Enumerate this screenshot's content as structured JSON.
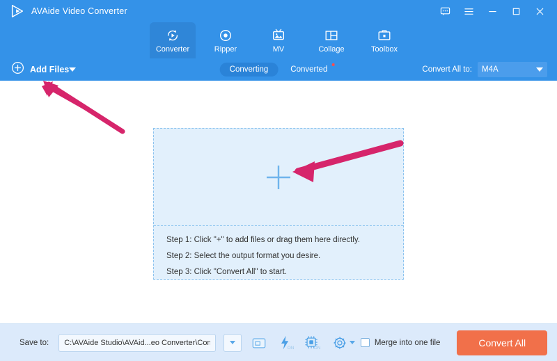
{
  "window": {
    "title": "AVAide Video Converter",
    "logo_icon": "play-triangle-logo",
    "controls": [
      {
        "name": "feedback",
        "icon": "chat-bubble-icon"
      },
      {
        "name": "menu",
        "icon": "hamburger-menu-icon"
      },
      {
        "name": "minimize",
        "icon": "minimize-icon"
      },
      {
        "name": "maximize",
        "icon": "maximize-icon"
      },
      {
        "name": "close",
        "icon": "close-icon"
      }
    ]
  },
  "tabs": [
    {
      "label": "Converter",
      "icon": "converter-icon",
      "active": true
    },
    {
      "label": "Ripper",
      "icon": "disc-icon",
      "active": false
    },
    {
      "label": "MV",
      "icon": "mv-image-icon",
      "active": false
    },
    {
      "label": "Collage",
      "icon": "collage-grid-icon",
      "active": false
    },
    {
      "label": "Toolbox",
      "icon": "toolbox-briefcase-icon",
      "active": false
    }
  ],
  "toolbar": {
    "add_files_label": "Add Files",
    "add_files_icon": "circle-plus-icon",
    "add_files_caret": "chevron-down-icon",
    "segments": [
      {
        "label": "Converting",
        "active": true,
        "badge": false
      },
      {
        "label": "Converted",
        "active": false,
        "badge": true
      }
    ],
    "convert_all_to_label": "Convert All to:",
    "format_value": "M4A"
  },
  "dropzone": {
    "plus_icon": "plus-icon",
    "steps": [
      "Step 1: Click \"+\" to add files or drag them here directly.",
      "Step 2: Select the output format you desire.",
      "Step 3: Click \"Convert All\" to start."
    ]
  },
  "bottom": {
    "save_to_label": "Save to:",
    "save_path": "C:\\AVAide Studio\\AVAid...eo Converter\\Converted",
    "path_caret_icon": "chevron-down-icon",
    "open_folder_icon": "folder-open-icon",
    "hardware_accel_icon": "lightning-bolt-icon",
    "hardware_accel_state": "ON",
    "gpu_accel_icon": "cpu-chip-icon",
    "gpu_accel_state": "ON",
    "settings_icon": "gear-icon",
    "settings_caret_icon": "chevron-down-icon",
    "merge_label": "Merge into one file",
    "merge_checked": false,
    "convert_all_label": "Convert All"
  },
  "annotations": {
    "arrow_color": "#d6256b",
    "arrows": [
      {
        "name": "arrow-to-add-files",
        "points_to": "Add Files"
      },
      {
        "name": "arrow-to-plus",
        "points_to": "plus icon in drop zone"
      }
    ]
  },
  "colors": {
    "header_blue": "#3492e8",
    "tab_active_blue": "#2f86d8",
    "dropzone_fill": "#e2f0fc",
    "dropzone_border": "#8bc3ef",
    "bottom_bar": "#dceafb",
    "accent_orange": "#f1704a",
    "annotation_pink": "#d6256b"
  }
}
